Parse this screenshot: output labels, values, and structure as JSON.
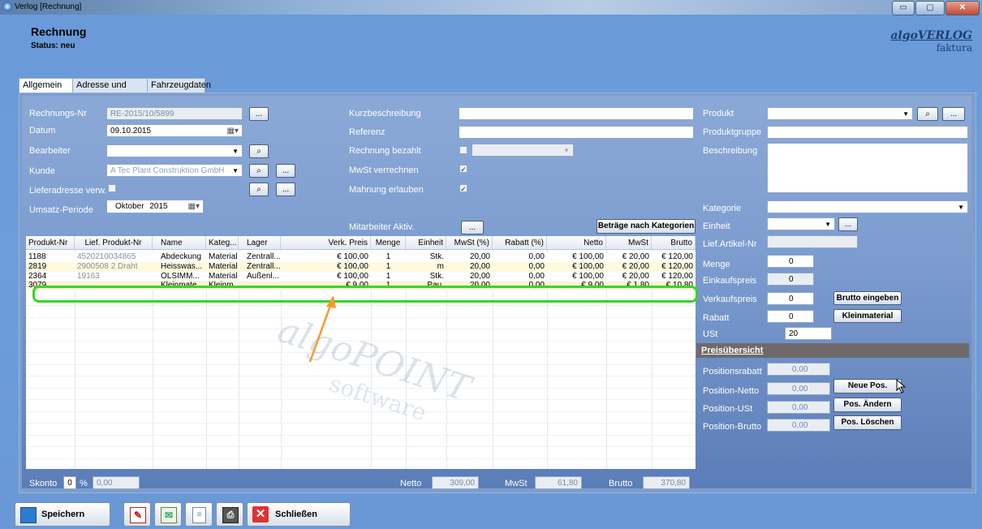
{
  "window": {
    "title": "Verlog [Rechnung]",
    "min": "▭",
    "max": "▢",
    "close": "✕"
  },
  "header": {
    "title": "Rechnung",
    "status": "Status: neu"
  },
  "brand": {
    "line1": "algoVERLOG",
    "line2": "faktura"
  },
  "tabs": [
    "Allgemein",
    "Adresse und Texte",
    "Fahrzeugdaten"
  ],
  "form": {
    "rechnungsnr_label": "Rechnungs-Nr",
    "rechnungsnr": "RE-2015/10/5899",
    "datum_label": "Datum",
    "datum": "09.10.2015",
    "bearbeiter_label": "Bearbeiter",
    "kunde_label": "Kunde",
    "kunde": "A Tec Plant Construktion GmbH",
    "liefer_label": "Lieferadresse verw.",
    "umsatz_label": "Umsatz-Periode",
    "umsatz_monat": "Oktober",
    "umsatz_jahr": "2015",
    "kurz_label": "Kurzbeschreibung",
    "referenz_label": "Referenz",
    "bezahlt_label": "Rechnung bezahlt",
    "mwst_label": "MwSt verrechnen",
    "mahnung_label": "Mahnung erlauben",
    "mitarbeiter_label": "Mitarbeiter Aktiv.",
    "betraege_btn": "Beträge nach Kategorien",
    "ellipsis": "...",
    "search": "⌕",
    "check": "✓"
  },
  "grid": {
    "columns": [
      "Produkt-Nr",
      "Lief. Produkt-Nr",
      "Name",
      "Kateg...",
      "Lager",
      "Verk. Preis",
      "Menge",
      "Einheit",
      "MwSt (%)",
      "Rabatt (%)",
      "Netto",
      "MwSt",
      "Brutto"
    ],
    "rows": [
      [
        "1188",
        "4520210034865",
        "Abdeckung",
        "Material",
        "Zentrall...",
        "€ 100,00",
        "1",
        "Stk.",
        "20,00",
        "0,00",
        "€ 100,00",
        "€ 20,00",
        "€ 120,00"
      ],
      [
        "2819",
        "2900508 2 Draht",
        "Heisswas...",
        "Material",
        "Zentrall...",
        "€ 100,00",
        "1",
        "m",
        "20,00",
        "0,00",
        "€ 100,00",
        "€ 20,00",
        "€ 120,00"
      ],
      [
        "2364",
        "19163",
        "ÖLSIMM...",
        "Material",
        "Außenl...",
        "€ 100,00",
        "1",
        "Stk.",
        "20,00",
        "0,00",
        "€ 100,00",
        "€ 20,00",
        "€ 120,00"
      ],
      [
        "3079",
        "",
        "Kleinmate...",
        "Kleinm...",
        "",
        "€ 9,00",
        "1",
        "Pau.",
        "20,00",
        "0,00",
        "€ 9,00",
        "€ 1,80",
        "€ 10,80"
      ]
    ]
  },
  "watermark": {
    "line1": "algoPOINT",
    "line2": "software"
  },
  "totals": {
    "skonto_label": "Skonto",
    "skonto": "0",
    "pct": "%",
    "skonto_betrag": "0,00",
    "netto_label": "Netto",
    "netto": "309,00",
    "mwst_label": "MwSt",
    "mwst": "61,80",
    "brutto_label": "Brutto",
    "brutto": "370,80"
  },
  "right": {
    "produkt_label": "Produkt",
    "gruppe_label": "Produktgruppe",
    "beschreibung_label": "Beschreibung",
    "kategorie_label": "Kategorie",
    "einheit_label": "Einheit",
    "liefartikel_label": "Lief.Artikel-Nr",
    "menge_label": "Menge",
    "menge": "0",
    "einkauf_label": "Einkaufspreis",
    "einkauf": "0",
    "verkauf_label": "Verkaufspreis",
    "verkauf": "0",
    "rabatt_label": "Rabatt",
    "rabatt": "0",
    "ust_label": "USt",
    "ust": "20",
    "brutto_btn": "Brutto eingeben",
    "klein_btn": "Kleinmaterial",
    "preis_hdr": "Preisübersicht",
    "posrabatt_label": "Positionsrabatt",
    "posrabatt": "0,00",
    "posnetto_label": "Position-Netto",
    "posnetto": "0,00",
    "posust_label": "Position-USt",
    "posust": "0,00",
    "posbrutto_label": "Position-Brutto",
    "posbrutto": "0,00",
    "neue_btn": "Neue Pos.",
    "aendern_btn": "Pos. Ändern",
    "loeschen_btn": "Pos. Löschen"
  },
  "toolbar": {
    "save": "Speichern",
    "close": "Schließen"
  }
}
